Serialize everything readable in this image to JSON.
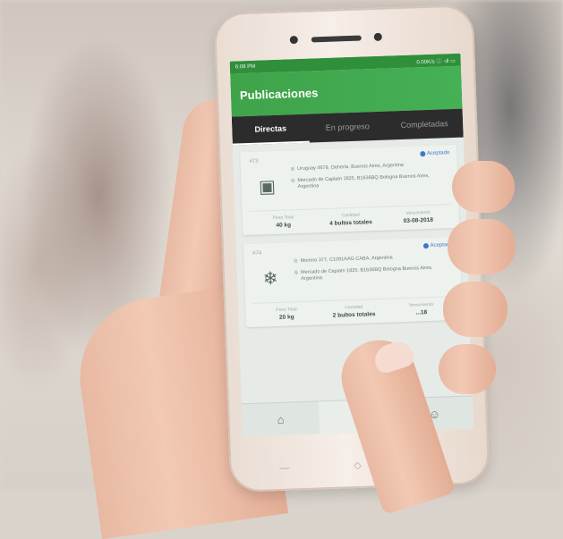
{
  "status_bar": {
    "time": "6:08 PM",
    "right": "0.00K/s ⓘ ·ıll ▭"
  },
  "app_bar": {
    "title": "Publicaciones"
  },
  "tabs": [
    {
      "label": "Directas",
      "active": true
    },
    {
      "label": "En progreso",
      "active": false
    },
    {
      "label": "Completadas",
      "active": false
    }
  ],
  "cards": [
    {
      "id": "#73",
      "status": "Aceptado",
      "icon": "box-icon",
      "origin": "Uruguay 4679, Oeheria, Buenos Aires, Argentina",
      "destination": "Mercado de Caplatn 1825, B1636BQ Bologna Buenos Aires, Argentina",
      "stats": [
        {
          "label": "Peso Total",
          "value": "40 kg"
        },
        {
          "label": "Cantidad",
          "value": "4 bultos totales"
        },
        {
          "label": "Vencimiento",
          "value": "03-08-2018"
        }
      ]
    },
    {
      "id": "#74",
      "status": "Aceptado",
      "icon": "snowflake-icon",
      "origin": "Moreno 377, C1091AAG CABA, Argentina",
      "destination": "Mercado de Capiatn 1825, B1636BQ Bologna Buenos Aires, Argentina",
      "stats": [
        {
          "label": "Peso Total",
          "value": "20 kg"
        },
        {
          "label": "Cantidad",
          "value": "2 bultos totales"
        },
        {
          "label": "Vencimiento",
          "value": "...18"
        }
      ]
    }
  ],
  "bottom_nav": [
    {
      "icon": "home-icon",
      "active": false
    },
    {
      "icon": "settings-icon",
      "active": true
    },
    {
      "icon": "user-icon",
      "active": false
    }
  ],
  "colors": {
    "accent": "#3fa34a",
    "tab_bar": "#2c2c2c",
    "status_blue": "#3a79c9"
  }
}
